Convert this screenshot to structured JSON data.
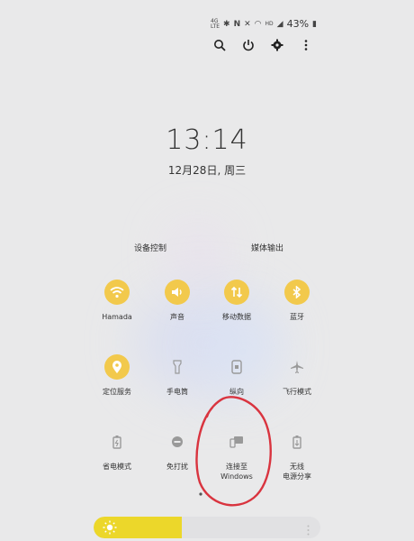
{
  "status_bar": {
    "battery": "43%",
    "icons": [
      "volte-icon",
      "bluetooth-icon",
      "nfc-icon",
      "mute-icon",
      "wifi-icon",
      "hd-icon",
      "signal-icon",
      "battery-icon"
    ]
  },
  "top_actions": [
    {
      "name": "search-icon"
    },
    {
      "name": "power-icon"
    },
    {
      "name": "settings-icon"
    },
    {
      "name": "more-icon"
    }
  ],
  "clock": {
    "time": "13:14",
    "date": "12月28日, 周三"
  },
  "segments": {
    "device_control": "设备控制",
    "media_output": "媒体输出"
  },
  "tiles": [
    {
      "label": "Hamada",
      "icon": "wifi-icon",
      "active": true
    },
    {
      "label": "声音",
      "icon": "sound-icon",
      "active": true
    },
    {
      "label": "移动数据",
      "icon": "mobile-data-icon",
      "active": true
    },
    {
      "label": "蓝牙",
      "icon": "bluetooth-icon",
      "active": true
    },
    {
      "label": "定位服务",
      "icon": "location-icon",
      "active": true
    },
    {
      "label": "手电筒",
      "icon": "flashlight-icon",
      "active": false
    },
    {
      "label": "纵向",
      "icon": "portrait-lock-icon",
      "active": false
    },
    {
      "label": "飞行模式",
      "icon": "airplane-icon",
      "active": false
    },
    {
      "label": "省电模式",
      "icon": "power-saving-icon",
      "active": false
    },
    {
      "label": "免打扰",
      "icon": "dnd-icon",
      "active": false
    },
    {
      "label_line1": "连接至",
      "label_line2": "Windows",
      "icon": "link-to-windows-icon",
      "active": false
    },
    {
      "label_line1": "无线",
      "label_line2": "电源分享",
      "icon": "wireless-powershare-icon",
      "active": false
    }
  ],
  "brightness": {
    "level": 0.39
  },
  "colors": {
    "accent": "#f2c94c",
    "brightness_fill": "#ecd72a",
    "annotation": "#d9343f"
  }
}
